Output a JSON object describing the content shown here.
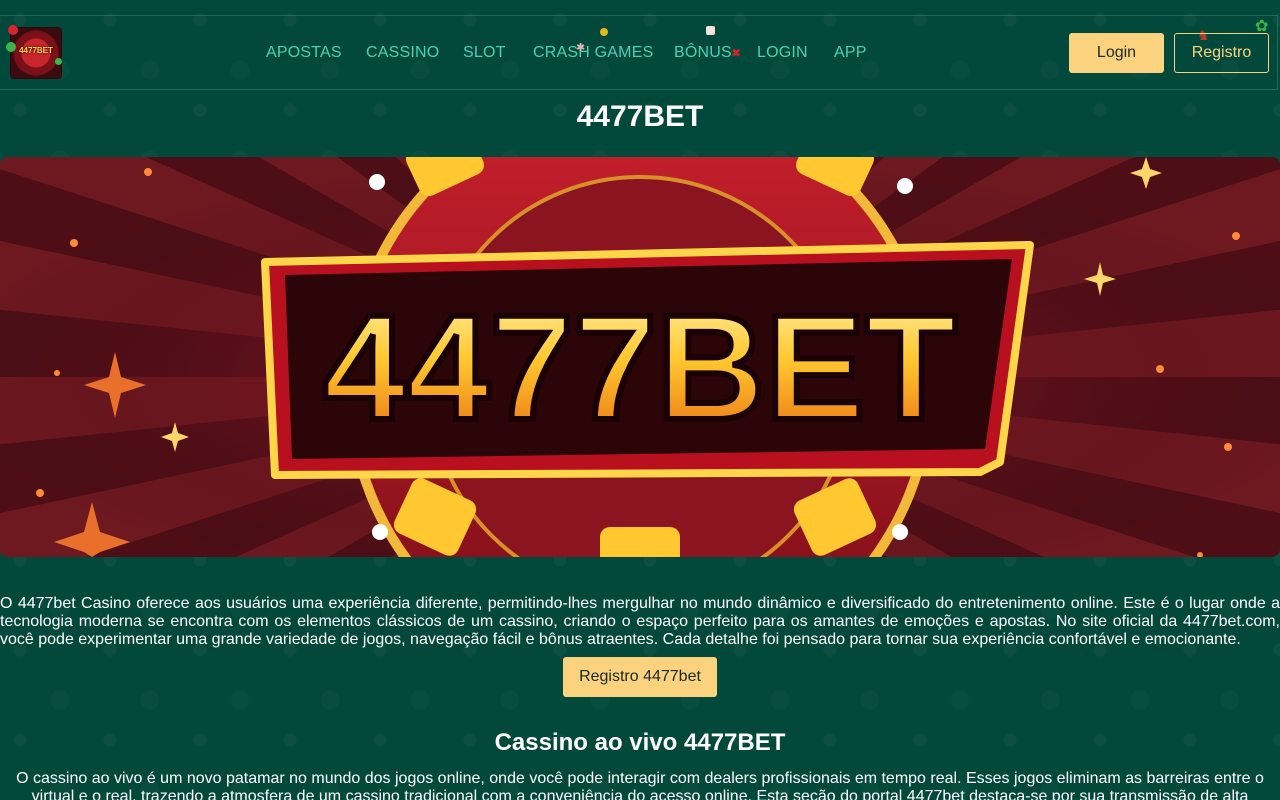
{
  "header": {
    "logo_text": "4477BET",
    "nav": [
      {
        "label": "APOSTAS"
      },
      {
        "label": "CASSINO"
      },
      {
        "label": "SLOT"
      },
      {
        "label": "CRASH GAMES"
      },
      {
        "label": "BÔNUS"
      },
      {
        "label": "LOGIN"
      },
      {
        "label": "APP"
      }
    ],
    "login_label": "Login",
    "register_label": "Registro"
  },
  "page_title": "4477BET",
  "banner": {
    "logo_text": "4477BET"
  },
  "intro_text": "O 4477bet Casino oferece aos usuários uma experiência diferente, permitindo-lhes mergulhar no mundo dinâmico e diversificado do entretenimento online. Este é o lugar onde a tecnologia moderna se encontra com os elementos clássicos de um cassino, criando o espaço perfeito para os amantes de emoções e apostas. No site oficial da 4477bet.com, você pode experimentar uma grande variedade de jogos, navegação fácil e bônus atraentes. Cada detalhe foi pensado para tornar sua experiência confortável e emocionante.",
  "cta_label": "Registro 4477bet",
  "live_casino": {
    "title": "Cassino ao vivo 4477BET",
    "text": "O cassino ao vivo é um novo patamar no mundo dos jogos online, onde você pode interagir com dealers profissionais em tempo real. Esses jogos eliminam as barreiras entre o virtual e o real, trazendo a atmosfera de um cassino tradicional com a conveniência do acesso online. Esta seção do portal 4477bet destaca-se por sua transmissão de alta"
  },
  "colors": {
    "background": "#03493b",
    "nav_link": "#4fd0b5",
    "accent": "#fbd27e"
  }
}
